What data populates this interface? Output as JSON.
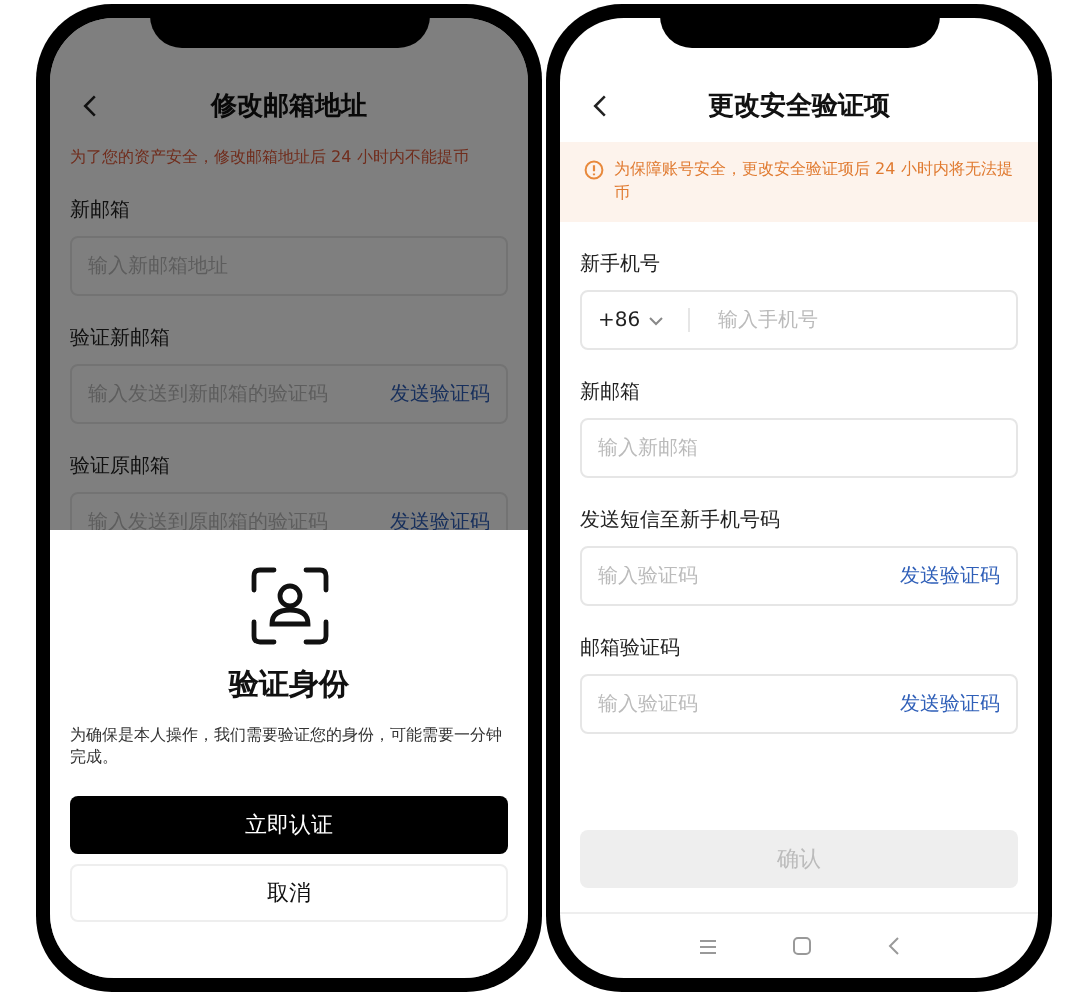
{
  "left": {
    "title": "修改邮箱地址",
    "warning": "为了您的资产安全，修改邮箱地址后 24 小时内不能提币",
    "fields": [
      {
        "label": "新邮箱",
        "placeholder": "输入新邮箱地址"
      },
      {
        "label": "验证新邮箱",
        "placeholder": "输入发送到新邮箱的验证码",
        "action": "发送验证码"
      },
      {
        "label": "验证原邮箱",
        "placeholder": "输入发送到原邮箱的验证码",
        "action": "发送验证码"
      }
    ],
    "dimmed": true,
    "sheet": {
      "title": "验证身份",
      "text": "为确保是本人操作，我们需要验证您的身份，可能需要一分钟完成。",
      "primary": "立即认证",
      "secondary": "取消"
    }
  },
  "right": {
    "title": "更改安全验证项",
    "notice": "为保障账号安全，更改安全验证项后 24 小时内将无法提币",
    "fields": [
      {
        "kind": "phone",
        "label": "新手机号",
        "prefix": "+86",
        "placeholder": "输入手机号"
      },
      {
        "kind": "plain",
        "label": "新邮箱",
        "placeholder": "输入新邮箱"
      },
      {
        "kind": "code",
        "label": "发送短信至新手机号码",
        "placeholder": "输入验证码",
        "action": "发送验证码"
      },
      {
        "kind": "code",
        "label": "邮箱验证码",
        "placeholder": "输入验证码",
        "action": "发送验证码"
      }
    ],
    "confirm": {
      "label": "确认",
      "disabled": true
    }
  }
}
